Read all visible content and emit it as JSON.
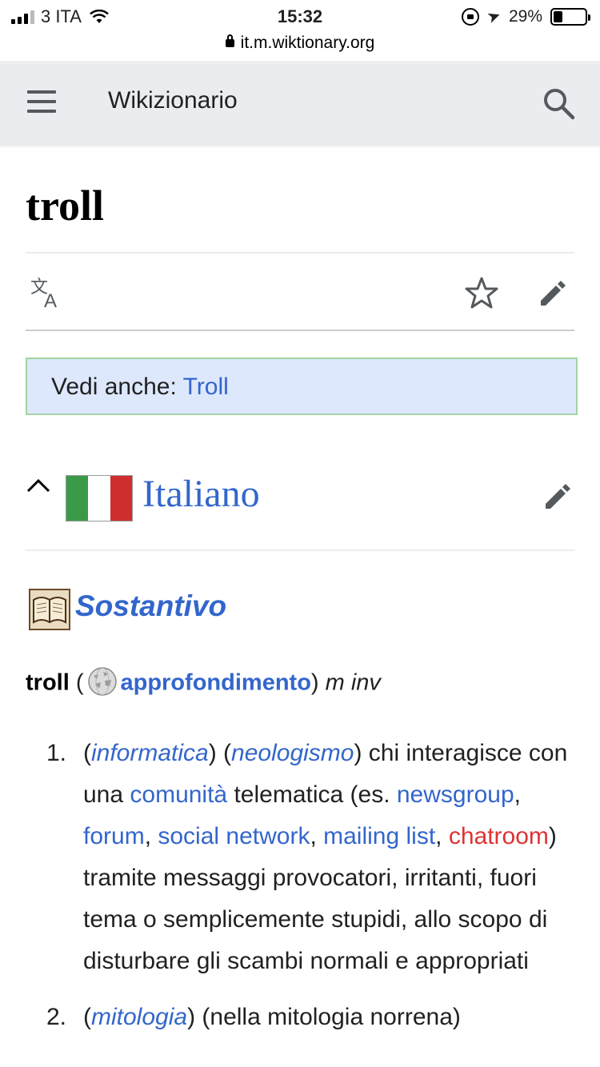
{
  "status_bar": {
    "carrier": "3 ITA",
    "time": "15:32",
    "battery": "29%",
    "battery_level": 0.29,
    "url": "it.m.wiktionary.org"
  },
  "header": {
    "site_title": "Wikizionario"
  },
  "page": {
    "title": "troll"
  },
  "notice": {
    "prefix": "Vedi anche: ",
    "link": "Troll"
  },
  "section": {
    "title": "Italiano",
    "flag_colors": [
      "#3a9a48",
      "#ffffff",
      "#cf2e2e"
    ]
  },
  "pos": {
    "title": "Sostantivo"
  },
  "headword": {
    "word": "troll",
    "open_paren": " (",
    "link": "approfondimento",
    "close_paren": ")",
    "grammar": " m inv"
  },
  "definitions": [
    {
      "num": "1.",
      "parts": {
        "p0": "(",
        "l_informatica": "informatica",
        "p1": ") (",
        "l_neologismo": "neologismo",
        "p2": ") chi interagisce con una ",
        "l_comunita": "comunità",
        "p3": " telematica (es. ",
        "l_newsgroup": "newsgroup",
        "p4": ", ",
        "l_forum": "forum",
        "p5": ", ",
        "l_social": "social network",
        "p6": ", ",
        "l_mailing": "mailing list",
        "p7": ", ",
        "l_chatroom": "chatroom",
        "p8": ") tramite messaggi provocatori, irritanti, fuori tema o semplicemente stupidi, allo scopo di disturbare gli scambi normali e appropriati"
      }
    },
    {
      "num": "2.",
      "parts": {
        "p0": "(",
        "l_mitologia": "mitologia",
        "p1": ") (nella mitologia norrena)"
      }
    }
  ],
  "colors": {
    "link": "#3366cc",
    "redlink": "#dd3333",
    "header_bg": "#eaecf0",
    "notice_bg": "#dee8fc",
    "notice_border": "#a3d3a3"
  }
}
